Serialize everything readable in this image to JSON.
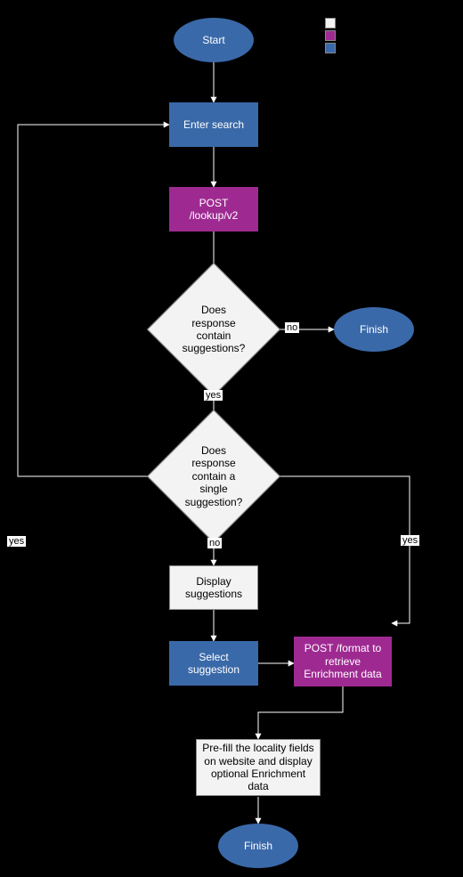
{
  "nodes": {
    "start": "Start",
    "enter_search": "Enter search",
    "post_lookup": "POST /lookup/v2",
    "d1": "Does response contain suggestions?",
    "finish_right": "Finish",
    "d2": "Does response contain a single suggestion?",
    "display_suggestions": "Display suggestions",
    "select_suggestion": "Select suggestion",
    "post_format": "POST /format to retrieve Enrichment data",
    "prefill": "Pre-fill the locality fields on website and display optional Enrichment data",
    "finish_bottom": "Finish"
  },
  "edges": {
    "d1_no": "no",
    "d1_yes": "yes",
    "d2_no": "no",
    "d2_yes_left": "yes",
    "d2_yes_right": "yes"
  },
  "legend": {
    "white": "",
    "magenta": "",
    "blue": ""
  },
  "colors": {
    "blue": "#3a69a9",
    "magenta": "#9e2a91",
    "white": "#f3f3f3"
  }
}
